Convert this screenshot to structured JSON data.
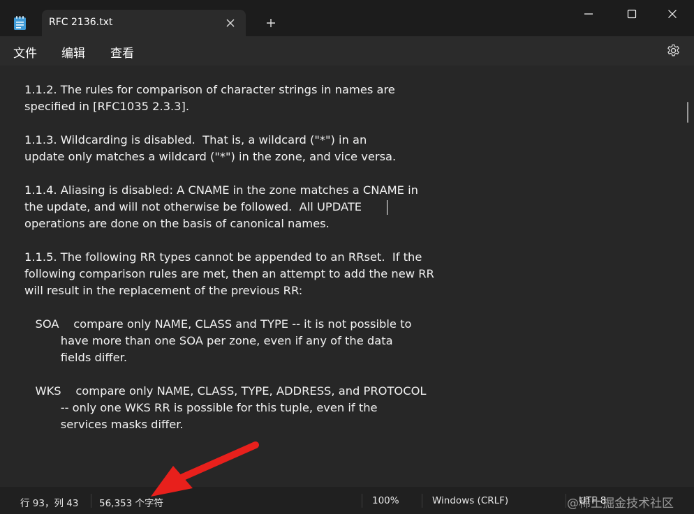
{
  "window": {
    "tab_title": "RFC 2136.txt"
  },
  "menu": {
    "file": "文件",
    "edit": "编辑",
    "view": "查看"
  },
  "editor": {
    "content": "1.1.2. The rules for comparison of character strings in names are\nspecified in [RFC1035 2.3.3].\n\n1.1.3. Wildcarding is disabled.  That is, a wildcard (\"*\") in an\nupdate only matches a wildcard (\"*\") in the zone, and vice versa.\n\n1.1.4. Aliasing is disabled: A CNAME in the zone matches a CNAME in\nthe update, and will not otherwise be followed.  All UPDATE\noperations are done on the basis of canonical names.\n\n1.1.5. The following RR types cannot be appended to an RRset.  If the\nfollowing comparison rules are met, then an attempt to add the new RR\nwill result in the replacement of the previous RR:\n\n   SOA    compare only NAME, CLASS and TYPE -- it is not possible to\n          have more than one SOA per zone, even if any of the data\n          fields differ.\n\n   WKS    compare only NAME, CLASS, TYPE, ADDRESS, and PROTOCOL\n          -- only one WKS RR is possible for this tuple, even if the\n          services masks differ."
  },
  "status": {
    "position": "行 93，列 43",
    "char_count": "56,353 个字符",
    "zoom": "100%",
    "line_ending": "Windows (CRLF)",
    "encoding": "UTF-8"
  },
  "watermark": "@稀土掘金技术社区",
  "colors": {
    "titlebar": "#1c1c1c",
    "tab": "#2b2b2b",
    "editor_bg": "#272727",
    "annotation_arrow": "#e8201c"
  },
  "icons": {
    "app": "notepad-icon",
    "tab_close": "close-icon",
    "new_tab": "plus-icon",
    "minimize": "minimize-icon",
    "maximize": "maximize-icon",
    "close": "close-icon",
    "settings": "gear-icon"
  }
}
